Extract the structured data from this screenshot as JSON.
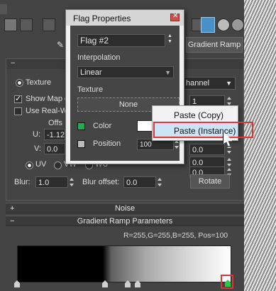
{
  "toolbar": {
    "icons": [
      "checker-icon",
      "material-icon",
      "swatch-icon",
      "tool-icon",
      "tool-icon-2",
      "tool-icon-3",
      "map-active-icon",
      "sphere-icon",
      "sphere-icon-2"
    ]
  },
  "topbar": {
    "gradient_ramp_button": "Gradient Ramp"
  },
  "coords": {
    "texture_radio": "Texture",
    "show_map": "Show Map o",
    "use_real": "Use Real-W",
    "offset_label": "Offs",
    "u_label": "U:",
    "u_value": "-1.12",
    "v_label": "V:",
    "v_value": "0.0",
    "channel_select": "hannel",
    "channel_value": "1",
    "tiling_u": "0.0",
    "tiling_v": "0.0",
    "uv": "UV",
    "vw": "VW",
    "wu": "WU",
    "rot_value": "0.0",
    "blur_label": "Blur:",
    "blur_value": "1.0",
    "blur_offset_label": "Blur offset:",
    "blur_offset_value": "0.0",
    "rotate_button": "Rotate"
  },
  "sections": {
    "coordinates_toggle": "−",
    "noise_toggle": "+",
    "noise": "Noise",
    "ramp_toggle": "−",
    "ramp": "Gradient Ramp Parameters"
  },
  "ramp": {
    "readout": "R=255,G=255,B=255, Pos=100"
  },
  "dialog": {
    "title": "Flag Properties",
    "flag_name": "Flag #2",
    "interpolation_label": "Interpolation",
    "interpolation_value": "Linear",
    "texture_label": "Texture",
    "texture_button": "None",
    "color_label": "Color",
    "position_label": "Position",
    "position_value": "100"
  },
  "context_menu": {
    "items": [
      "Paste (Copy)",
      "Paste (Instance)"
    ]
  },
  "colors": {
    "highlight_box": "#d9383a",
    "menu_hover": "#cce4f7"
  }
}
